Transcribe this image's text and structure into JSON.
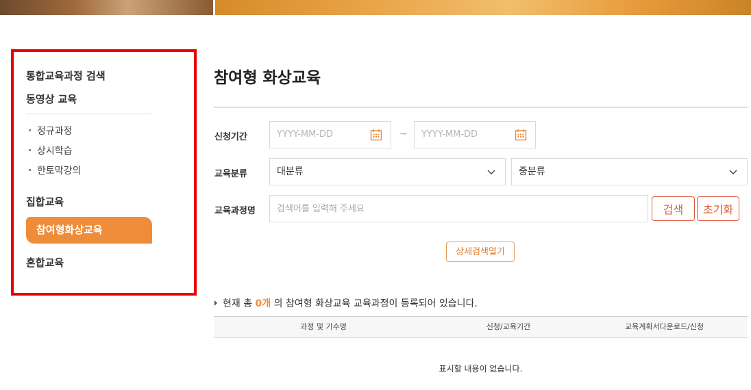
{
  "sidebar": {
    "items_top": [
      {
        "label": "통합교육과정 검색"
      },
      {
        "label": "동영상 교육"
      }
    ],
    "sub_items": [
      {
        "label": "정규과정"
      },
      {
        "label": "상시학습"
      },
      {
        "label": "한토막강의"
      }
    ],
    "group": {
      "label": "집합교육"
    },
    "active": {
      "label": "참여형화상교육"
    },
    "bottom": {
      "label": "혼합교육"
    }
  },
  "main": {
    "title": "참여형 화상교육",
    "form": {
      "period_label": "신청기간",
      "date_from_placeholder": "YYYY-MM-DD",
      "date_to_placeholder": "YYYY-MM-DD",
      "tilde": "~",
      "category_label": "교육분류",
      "major_category": "대분류",
      "minor_category": "중분류",
      "course_label": "교육과정명",
      "course_placeholder": "검색어를 입력해 주세요",
      "search_button": "검색",
      "reset_button": "초기화",
      "detail_button": "상세검색열기"
    },
    "count": {
      "prefix": "현재 총",
      "value": "0개",
      "suffix": "의 참여형 화상교육 교육과정이 등록되어 있습니다."
    },
    "table": {
      "columns": [
        "과정 및 기수명",
        "신청/교육기간",
        "교육계획서다운로드/신청"
      ],
      "empty_message": "표시할 내용이 없습니다."
    }
  },
  "colors": {
    "accent": "#ef8c3a",
    "highlight_border": "#e60000",
    "button_red": "#e0583a"
  },
  "icons": [
    "calendar-icon",
    "chevron-down-icon",
    "triangle-bullet-icon"
  ]
}
